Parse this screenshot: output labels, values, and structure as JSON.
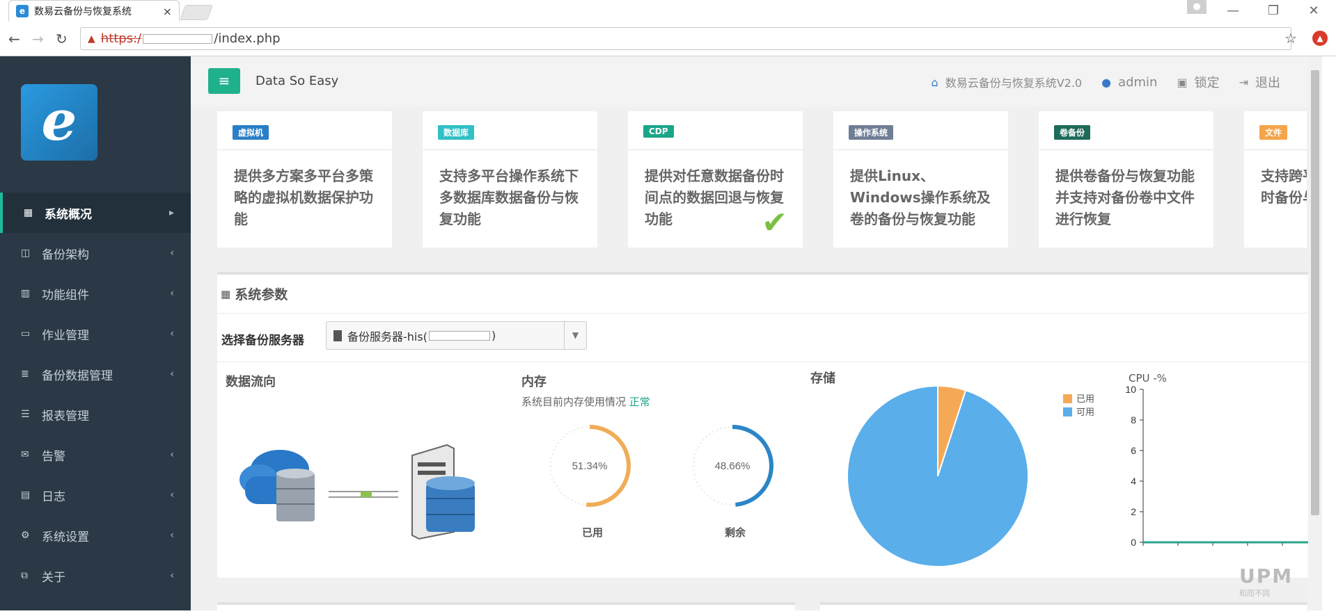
{
  "browser": {
    "tab_title": "数易云备份与恢复系统",
    "tab_close": "×",
    "url_scheme": "https:/",
    "url_path": "/index.php",
    "nav": {
      "back": "←",
      "forward": "→",
      "reload": "↻"
    },
    "star": "☆",
    "window_controls": {
      "minimize": "—",
      "restore": "❐",
      "close": "✕"
    }
  },
  "sidebar": {
    "logo_glyph": "e",
    "items": [
      {
        "label": "系统概况",
        "icon": "grid-icon",
        "glyph": "▦",
        "active": true,
        "arrow": "▸"
      },
      {
        "label": "备份架构",
        "icon": "columns-icon",
        "glyph": "◫",
        "arrow": "‹"
      },
      {
        "label": "功能组件",
        "icon": "chart-icon",
        "glyph": "▥",
        "arrow": "‹"
      },
      {
        "label": "作业管理",
        "icon": "monitor-icon",
        "glyph": "▭",
        "arrow": "‹"
      },
      {
        "label": "备份数据管理",
        "icon": "database-icon",
        "glyph": "≣",
        "arrow": "‹"
      },
      {
        "label": "报表管理",
        "icon": "list-icon",
        "glyph": "☰",
        "arrow": ""
      },
      {
        "label": "告警",
        "icon": "mail-icon",
        "glyph": "✉",
        "arrow": "‹"
      },
      {
        "label": "日志",
        "icon": "table-icon",
        "glyph": "▤",
        "arrow": "‹"
      },
      {
        "label": "系统设置",
        "icon": "gear-icon",
        "glyph": "⚙",
        "arrow": "‹"
      },
      {
        "label": "关于",
        "icon": "copy-icon",
        "glyph": "⧉",
        "arrow": "‹"
      }
    ]
  },
  "topnav": {
    "toggle_glyph": "≡",
    "brand": "Data So Easy",
    "system_name": "数易云备份与恢复系统V2.0",
    "user": "admin",
    "lock": "锁定",
    "logout": "退出"
  },
  "features": [
    {
      "tag": "虚拟机",
      "color": "#2a7fc7",
      "text": "提供多方案多平台多策略的虚拟机数据保护功能"
    },
    {
      "tag": "数据库",
      "color": "#30c0c6",
      "text": "支持多平台操作系统下多数据库数据备份与恢复功能"
    },
    {
      "tag": "CDP",
      "color": "#1aa589",
      "text": "提供对任意数据备份时间点的数据回退与恢复功能"
    },
    {
      "tag": "操作系统",
      "color": "#6f7e95",
      "text": "提供Linux、Windows操作系统及卷的备份与恢复功能"
    },
    {
      "tag": "卷备份",
      "color": "#1d6b5b",
      "text": "提供卷备份与恢复功能并支持对备份卷中文件进行恢复"
    },
    {
      "tag": "文件",
      "color": "#f4a54b",
      "text": "支持跨平台海量文件定时备份与恢复功能"
    }
  ],
  "params": {
    "title": "系统参数",
    "server_label": "选择备份服务器",
    "server_value_prefix": "备份服务器-his(",
    "server_value_suffix": ")",
    "flow_title": "数据流向",
    "memory_title": "内存",
    "memory_status_text": "系统目前内存使用情况",
    "memory_status_value": "正常",
    "storage_title": "存储",
    "cpu_title": "CPU -%"
  },
  "memory": {
    "used_pct": 51.34,
    "free_pct": 48.66,
    "used_label": "已用",
    "free_label": "剩余",
    "used_text": "51.34%",
    "free_text": "48.66%",
    "used_color": "#f0ad57",
    "free_color": "#2b85c7"
  },
  "chart_data": [
    {
      "type": "pie",
      "title": "存储",
      "legend": [
        "已用",
        "可用"
      ],
      "values": [
        5,
        95
      ],
      "colors": [
        "#f5a957",
        "#5aaeea"
      ],
      "legend_position": "top-right"
    },
    {
      "type": "line",
      "title": "CPU -%",
      "ylim": [
        0,
        10
      ],
      "yticks": [
        0,
        2,
        4,
        6,
        8,
        10
      ],
      "x": [
        0,
        1,
        2,
        3,
        4,
        5
      ],
      "series": [
        {
          "values": [
            0,
            0,
            0,
            0,
            0,
            0
          ]
        }
      ],
      "line_color": "#29a38a",
      "grid": false
    }
  ],
  "watermark": {
    "main": "UPM",
    "sub": "和而不同"
  }
}
